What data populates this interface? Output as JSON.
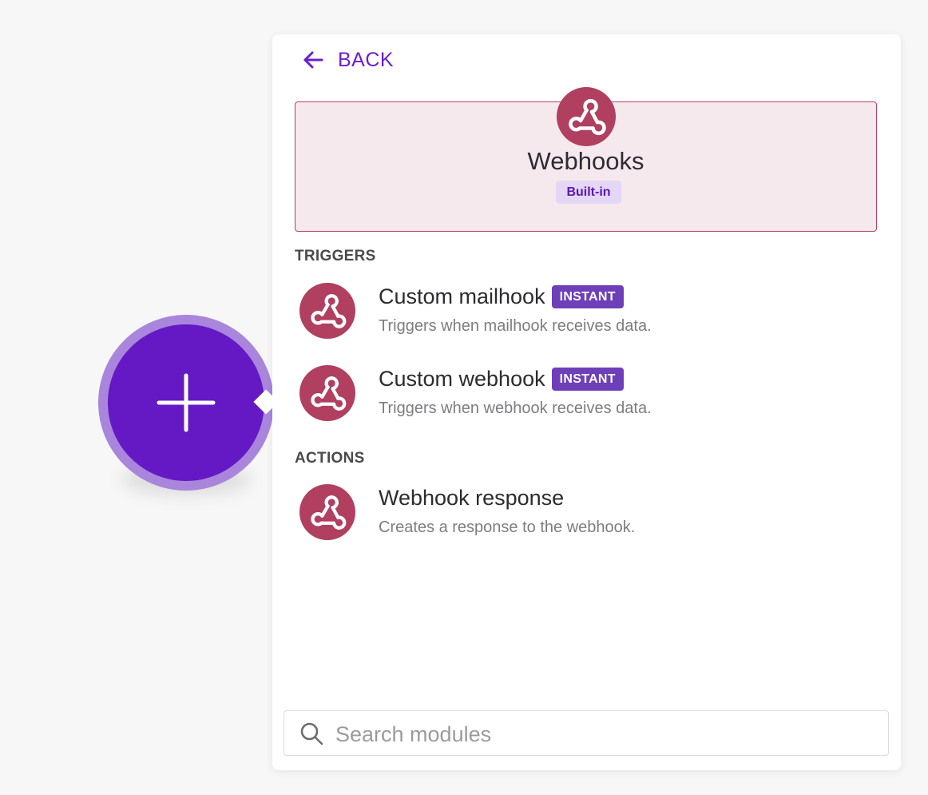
{
  "back": {
    "label": "BACK"
  },
  "app": {
    "name": "Webhooks",
    "badge": "Built-in",
    "icon": "webhook-icon"
  },
  "sections": {
    "triggers": {
      "heading": "TRIGGERS",
      "items": [
        {
          "title": "Custom mailhook",
          "badge": "INSTANT",
          "description": "Triggers when mailhook receives data."
        },
        {
          "title": "Custom webhook",
          "badge": "INSTANT",
          "description": "Triggers when webhook receives data."
        }
      ]
    },
    "actions": {
      "heading": "ACTIONS",
      "items": [
        {
          "title": "Webhook response",
          "description": "Creates a response to the webhook."
        }
      ]
    }
  },
  "search": {
    "placeholder": "Search modules",
    "value": ""
  },
  "colors": {
    "brand_purple": "#6419c5",
    "webhook_icon_bg": "#b03f60",
    "instant_badge_bg": "#6d3fb8",
    "header_bg": "#f5e9ee"
  }
}
